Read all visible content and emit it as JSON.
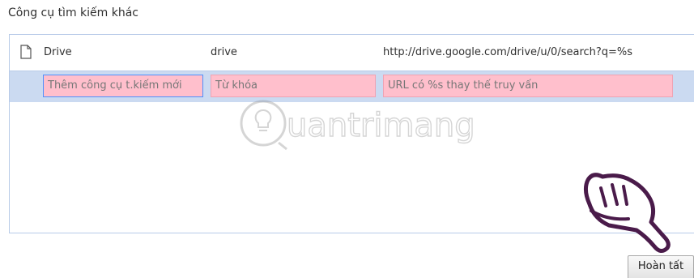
{
  "section_title": "Công cụ tìm kiếm khác",
  "engines": [
    {
      "name": "Drive",
      "keyword": "drive",
      "url": "http://drive.google.com/drive/u/0/search?q=%s"
    }
  ],
  "new_engine": {
    "name_placeholder": "Thêm công cụ t.kiếm mới",
    "keyword_placeholder": "Từ khóa",
    "url_placeholder": "URL có %s thay thế truy vấn"
  },
  "watermark": "uantrimang",
  "done_button": "Hoàn tất",
  "colors": {
    "selected_row": "#cbdaf1",
    "invalid_field": "#ffbfcc",
    "focus_border": "#4d90fe",
    "table_border": "#b8cbe8"
  },
  "icons": [
    "page-icon",
    "pointing-hand-icon",
    "lightbulb-logo-icon"
  ]
}
